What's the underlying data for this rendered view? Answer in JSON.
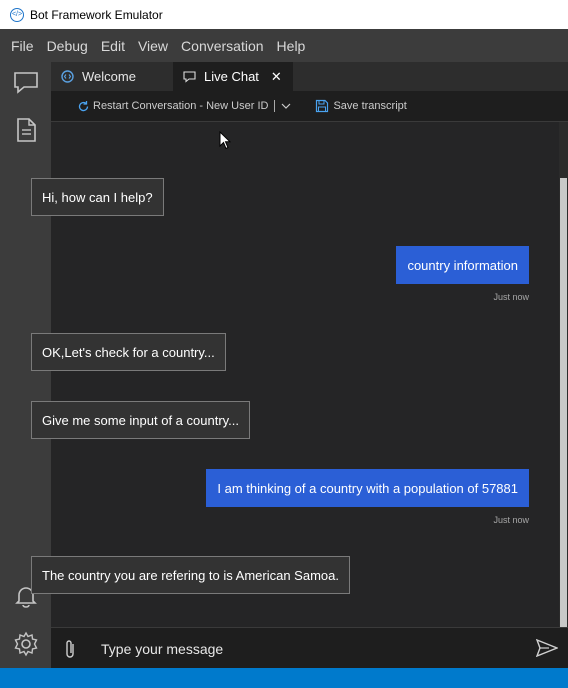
{
  "window": {
    "title": "Bot Framework Emulator"
  },
  "menu": [
    "File",
    "Debug",
    "Edit",
    "View",
    "Conversation",
    "Help"
  ],
  "tabs": [
    {
      "label": "Welcome",
      "icon": "emulator-logo-icon",
      "active": false
    },
    {
      "label": "Live Chat",
      "icon": "chat-icon",
      "active": true,
      "close": "✕"
    }
  ],
  "toolbar": {
    "restart_label": "Restart Conversation - New User ID",
    "save_label": "Save transcript"
  },
  "messages": [
    {
      "from": "bot",
      "text": "Hi, how can I help?"
    },
    {
      "from": "user",
      "text": "country information",
      "timestamp": "Just now"
    },
    {
      "from": "bot",
      "text": "OK,Let's check for a country..."
    },
    {
      "from": "bot",
      "text": "Give me some input of a country..."
    },
    {
      "from": "user",
      "text": "I am thinking of a country with a population of 57881",
      "timestamp": "Just now"
    },
    {
      "from": "bot",
      "text": "The country you are refering to is American Samoa."
    }
  ],
  "input": {
    "placeholder": "Type your message"
  },
  "colors": {
    "user_bubble": "#2b5fd6",
    "bot_bubble": "#333333",
    "status_bar": "#007acc",
    "app_bg": "#252526"
  }
}
